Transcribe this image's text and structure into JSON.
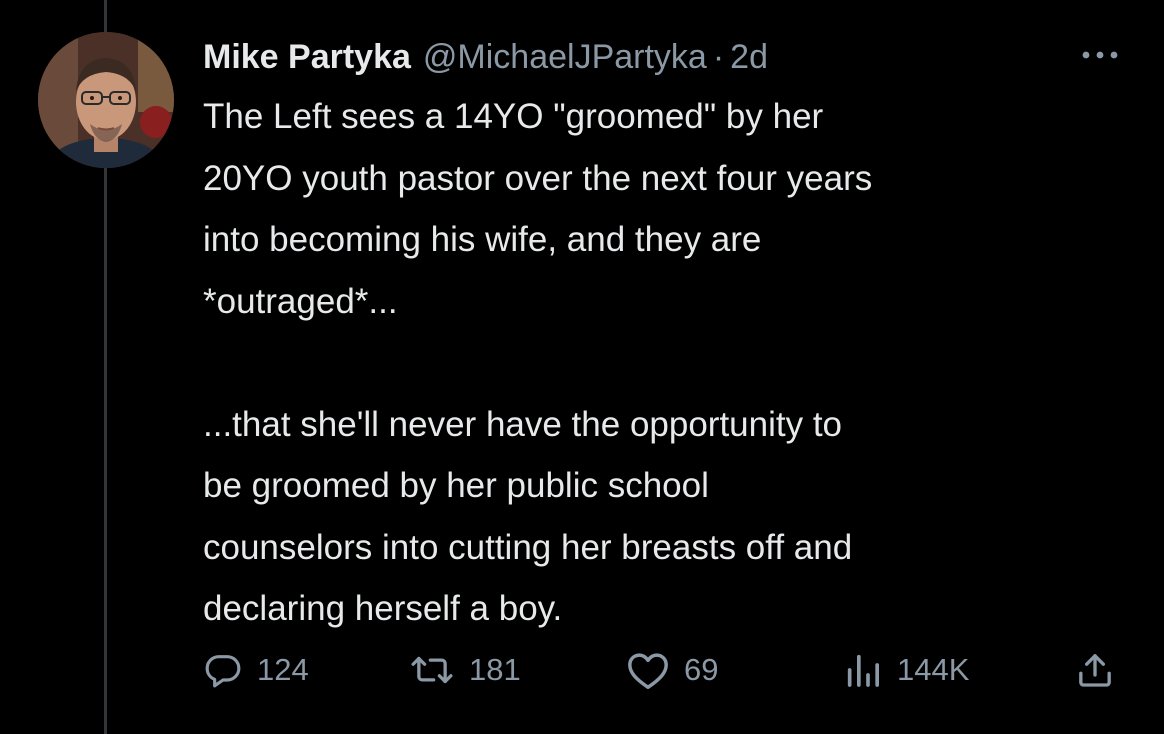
{
  "tweet": {
    "author": {
      "display_name": "Mike Partyka",
      "handle": "@MichaelJPartyka",
      "separator": "·",
      "timestamp": "2d"
    },
    "text": "The Left sees a 14YO \"groomed\" by her\n20YO youth pastor over the next four years\ninto becoming his wife, and they are\n*outraged*...\n\n...that she'll never have the opportunity to\nbe groomed by her public school\ncounselors into cutting her breasts off and\ndeclaring herself a boy.",
    "actions": {
      "replies": {
        "icon": "reply-icon",
        "count": "124"
      },
      "reposts": {
        "icon": "repost-icon",
        "count": "181"
      },
      "likes": {
        "icon": "like-icon",
        "count": "69"
      },
      "views": {
        "icon": "views-icon",
        "count": "144K"
      },
      "share": {
        "icon": "share-icon"
      }
    },
    "more_icon": "more-options-icon"
  },
  "colors": {
    "background": "#000000",
    "text_primary": "#e7e9ea",
    "text_secondary": "#8b98a5",
    "thread_line": "#333639"
  }
}
